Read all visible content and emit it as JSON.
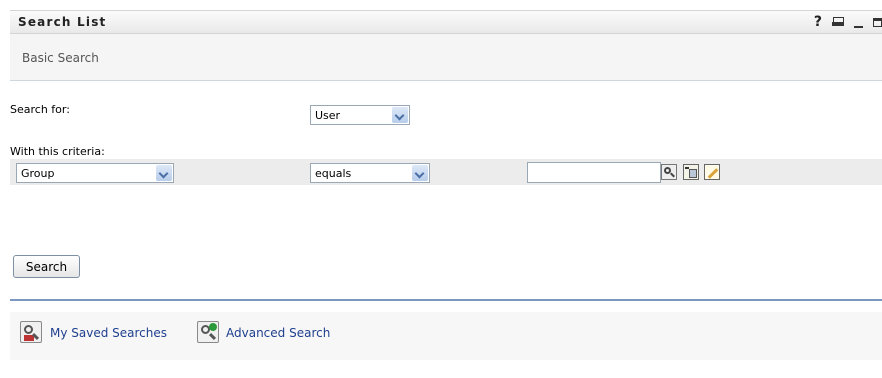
{
  "window": {
    "title": "Search List",
    "help_label": "?"
  },
  "subheader": {
    "title": "Basic Search"
  },
  "form": {
    "search_for_label": "Search for:",
    "search_for_value": "User",
    "criteria_label": "With this criteria:",
    "attribute_value": "Group",
    "operator_value": "equals",
    "criteria_text_value": "",
    "search_button_label": "Search"
  },
  "footer": {
    "saved_searches_label": "My Saved Searches",
    "advanced_search_label": "Advanced Search"
  },
  "icons": {
    "help": "help-icon",
    "print": "print-icon",
    "minimize": "minimize-icon",
    "maximize": "maximize-icon",
    "object_lookup": "object-lookup-icon",
    "history": "history-icon",
    "edit": "edit-icon",
    "saved_searches": "saved-searches-icon",
    "advanced_search": "advanced-search-icon"
  },
  "colors": {
    "link": "#1f3f8f",
    "separator": "#7a98c0",
    "dropdown_button": "#b7cdeb"
  }
}
